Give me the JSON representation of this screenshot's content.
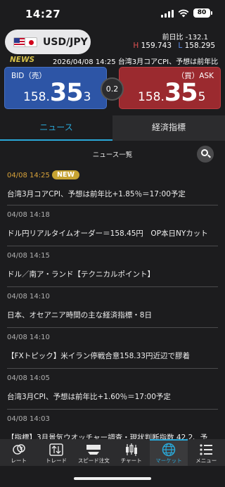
{
  "status_bar": {
    "time": "14:27",
    "battery": "80",
    "icons": [
      "signal-icon",
      "wifi-icon",
      "battery-icon"
    ]
  },
  "pair": {
    "name": "USD/JPY",
    "prev_change_label": "前日比",
    "prev_change_value": "-132.1",
    "high_label": "H",
    "high_value": "159.743",
    "low_label": "L",
    "low_value": "158.295"
  },
  "ticker": {
    "label": "NEWS",
    "text": "2026/04/08 14:25  台湾3月コアCPI、予想は前年比"
  },
  "rates": {
    "bid_label": "BID（売）",
    "bid_big": "158.",
    "bid_mid": "35",
    "bid_small": "3",
    "ask_label": "（買）ASK",
    "ask_big": "158.",
    "ask_mid": "35",
    "ask_small": "5",
    "spread": "0.2"
  },
  "tabs": [
    {
      "label": "ニュース",
      "active": true
    },
    {
      "label": "経済指標",
      "active": false
    }
  ],
  "news_header": {
    "title": "ニュース一覧"
  },
  "news": [
    {
      "date": "04/08 14:25",
      "badge": "NEW",
      "title": "台湾3月コアCPI、予想は前年比+1.85％＝17:00予定"
    },
    {
      "date": "04/08 14:18",
      "title": "ドル円リアルタイムオーダー＝158.45円　OP本日NYカット"
    },
    {
      "date": "04/08 14:15",
      "title": "ドル／南ア・ランド【テクニカルポイント】"
    },
    {
      "date": "04/08 14:10",
      "title": "日本、オセアニア時間の主な経済指標・8日"
    },
    {
      "date": "04/08 14:10",
      "title": "【FXトピック】米イラン停戦合意158.33円近辺で膠着"
    },
    {
      "date": "04/08 14:05",
      "title": "台湾3月CPI、予想は前年比+1.60％＝17:00予定"
    },
    {
      "date": "04/08 14:03",
      "title": "【指標】3月景気ウオッチャー調査・現状判断指数 42.2、予"
    }
  ],
  "bottom_nav": [
    {
      "label": "レート",
      "icon": "rate-icon",
      "active": false
    },
    {
      "label": "トレード",
      "icon": "trade-icon",
      "active": false
    },
    {
      "label": "スピード注文",
      "icon": "speed-order-icon",
      "active": false
    },
    {
      "label": "チャート",
      "icon": "chart-icon",
      "active": false
    },
    {
      "label": "マーケット",
      "icon": "globe-icon",
      "active": true
    },
    {
      "label": "メニュー",
      "icon": "menu-icon",
      "active": false
    }
  ],
  "colors": {
    "accent": "#2aa8d8",
    "bid": "#2d55a6",
    "ask": "#9b2a2f",
    "news_gold": "#c6a332"
  }
}
